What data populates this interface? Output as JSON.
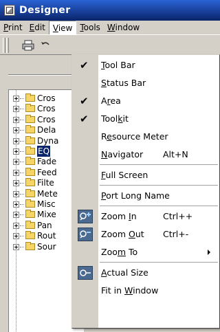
{
  "window": {
    "title": "Designer"
  },
  "menubar": [
    {
      "pre": "",
      "mnemonic": "P",
      "post": "rint",
      "open": false
    },
    {
      "pre": "",
      "mnemonic": "E",
      "post": "dit",
      "open": false
    },
    {
      "pre": "",
      "mnemonic": "V",
      "post": "iew",
      "open": true
    },
    {
      "pre": "",
      "mnemonic": "T",
      "post": "ools",
      "open": false
    },
    {
      "pre": "",
      "mnemonic": "W",
      "post": "indow",
      "open": false
    }
  ],
  "toolbar": {
    "icons": [
      "print-icon",
      "undo-icon"
    ]
  },
  "tree": {
    "items": [
      {
        "label": "Cros",
        "selected": false
      },
      {
        "label": "Cros",
        "selected": false
      },
      {
        "label": "Cros",
        "selected": false
      },
      {
        "label": "Dela",
        "selected": false
      },
      {
        "label": "Dyna",
        "selected": false
      },
      {
        "label": "EQ",
        "selected": true
      },
      {
        "label": "Fade",
        "selected": false
      },
      {
        "label": "Feed",
        "selected": false
      },
      {
        "label": "Filte",
        "selected": false
      },
      {
        "label": "Mete",
        "selected": false
      },
      {
        "label": "Misc",
        "selected": false
      },
      {
        "label": "Mixe",
        "selected": false
      },
      {
        "label": "Pan",
        "selected": false
      },
      {
        "label": "Rout",
        "selected": false
      },
      {
        "label": "Sour",
        "selected": false
      }
    ]
  },
  "view_menu": {
    "items": [
      {
        "pre": "",
        "mnemonic": "T",
        "post": "ool Bar",
        "checked": true,
        "shortcut": "",
        "icon": "",
        "submenu": false
      },
      {
        "pre": "",
        "mnemonic": "S",
        "post": "tatus Bar",
        "checked": false,
        "shortcut": "",
        "icon": "",
        "submenu": false
      },
      {
        "pre": "A",
        "mnemonic": "r",
        "post": "ea",
        "checked": true,
        "shortcut": "",
        "icon": "",
        "submenu": false
      },
      {
        "pre": "Tool",
        "mnemonic": "k",
        "post": "it",
        "checked": true,
        "shortcut": "",
        "icon": "",
        "submenu": false
      },
      {
        "pre": "R",
        "mnemonic": "e",
        "post": "source Meter",
        "checked": false,
        "shortcut": "",
        "icon": "",
        "submenu": false
      },
      {
        "pre": "",
        "mnemonic": "N",
        "post": "avigator",
        "checked": false,
        "shortcut": "Alt+N",
        "icon": "",
        "submenu": false
      },
      {
        "separator": true
      },
      {
        "pre": "",
        "mnemonic": "F",
        "post": "ull Screen",
        "checked": false,
        "shortcut": "",
        "icon": "",
        "submenu": false
      },
      {
        "separator": true
      },
      {
        "pre": "",
        "mnemonic": "P",
        "post": "ort Long Name",
        "checked": false,
        "shortcut": "",
        "icon": "",
        "submenu": false
      },
      {
        "separator": true
      },
      {
        "pre": "Zoom ",
        "mnemonic": "I",
        "post": "n",
        "checked": false,
        "shortcut": "Ctrl++",
        "icon": "zoom-in-icon",
        "submenu": false
      },
      {
        "pre": "Zoom ",
        "mnemonic": "O",
        "post": "ut",
        "checked": false,
        "shortcut": "Ctrl+-",
        "icon": "zoom-out-icon",
        "submenu": false
      },
      {
        "pre": "Zoo",
        "mnemonic": "m",
        "post": " To",
        "checked": false,
        "shortcut": "",
        "icon": "",
        "submenu": true
      },
      {
        "separator": true
      },
      {
        "pre": "",
        "mnemonic": "A",
        "post": "ctual Size",
        "checked": false,
        "shortcut": "",
        "icon": "actual-size-icon",
        "submenu": false
      },
      {
        "pre": "Fit in ",
        "mnemonic": "W",
        "post": "indow",
        "checked": false,
        "shortcut": "",
        "icon": "",
        "submenu": false
      }
    ]
  }
}
